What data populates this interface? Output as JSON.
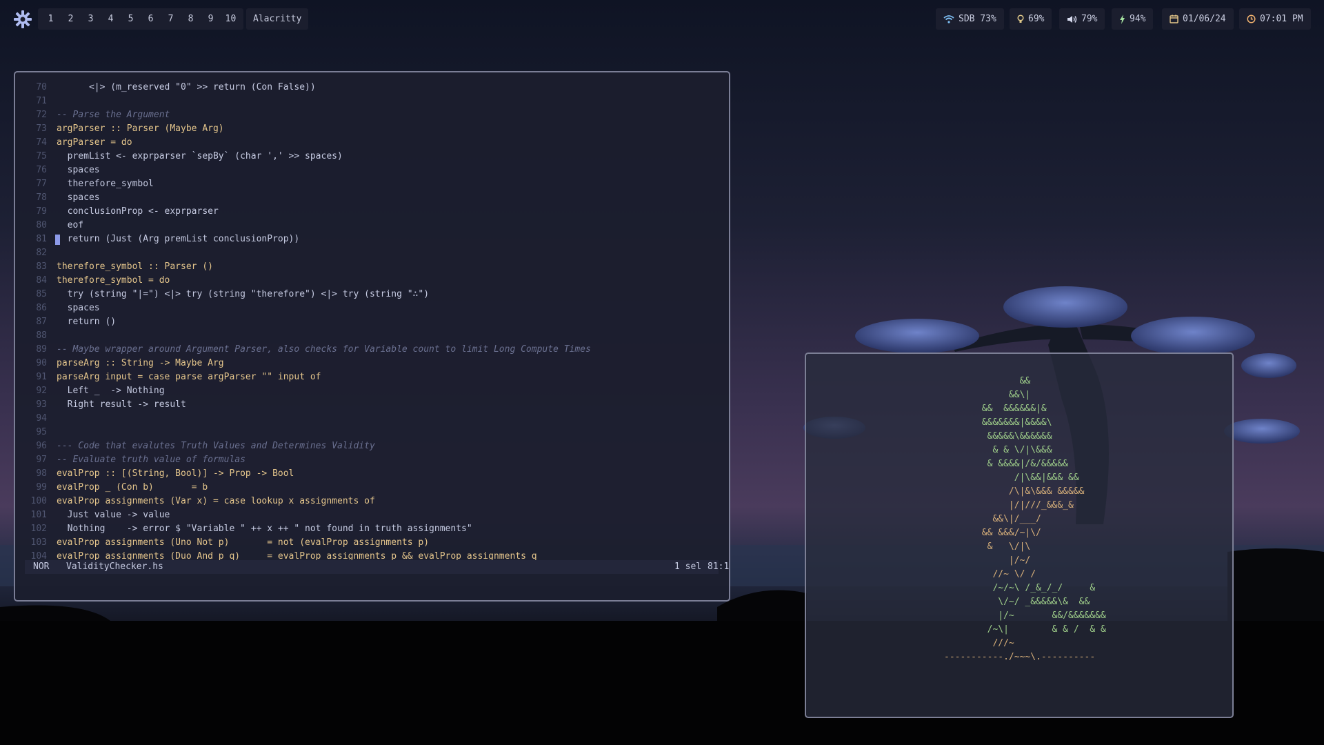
{
  "topbar": {
    "workspaces": [
      "1",
      "2",
      "3",
      "4",
      "5",
      "6",
      "7",
      "8",
      "9",
      "10"
    ],
    "active_app": "Alacritty",
    "status": {
      "wifi": "SDB 73%",
      "brightness": "69%",
      "volume": "79%",
      "battery": "94%",
      "date": "01/06/24",
      "time": "07:01 PM"
    },
    "icons": [
      "settings-icon",
      "wifi-icon",
      "brightness-icon",
      "volume-icon",
      "battery-icon",
      "calendar-icon",
      "clock-icon"
    ]
  },
  "editor": {
    "lines": [
      {
        "n": "70",
        "t": "      <|> (m_reserved \"0\" >> return (Con False))"
      },
      {
        "n": "71",
        "t": ""
      },
      {
        "n": "72",
        "t": "-- Parse the Argument"
      },
      {
        "n": "73",
        "t": "argParser :: Parser (Maybe Arg)"
      },
      {
        "n": "74",
        "t": "argParser = do"
      },
      {
        "n": "75",
        "t": "  premList <- exprparser `sepBy` (char ',' >> spaces)"
      },
      {
        "n": "76",
        "t": "  spaces"
      },
      {
        "n": "77",
        "t": "  therefore_symbol"
      },
      {
        "n": "78",
        "t": "  spaces"
      },
      {
        "n": "79",
        "t": "  conclusionProp <- exprparser"
      },
      {
        "n": "80",
        "t": "  eof"
      },
      {
        "n": "81",
        "t": "  return (Just (Arg premList conclusionProp))"
      },
      {
        "n": "82",
        "t": ""
      },
      {
        "n": "83",
        "t": "therefore_symbol :: Parser ()"
      },
      {
        "n": "84",
        "t": "therefore_symbol = do"
      },
      {
        "n": "85",
        "t": "  try (string \"|=\") <|> try (string \"therefore\") <|> try (string \"∴\")"
      },
      {
        "n": "86",
        "t": "  spaces"
      },
      {
        "n": "87",
        "t": "  return ()"
      },
      {
        "n": "88",
        "t": ""
      },
      {
        "n": "89",
        "t": "-- Maybe wrapper around Argument Parser, also checks for Variable count to limit Long Compute Times"
      },
      {
        "n": "90",
        "t": "parseArg :: String -> Maybe Arg"
      },
      {
        "n": "91",
        "t": "parseArg input = case parse argParser \"\" input of"
      },
      {
        "n": "92",
        "t": "  Left _  -> Nothing"
      },
      {
        "n": "93",
        "t": "  Right result -> result"
      },
      {
        "n": "94",
        "t": ""
      },
      {
        "n": "95",
        "t": ""
      },
      {
        "n": "96",
        "t": "--- Code that evalutes Truth Values and Determines Validity"
      },
      {
        "n": "97",
        "t": "-- Evaluate truth value of formulas"
      },
      {
        "n": "98",
        "t": "evalProp :: [(String, Bool)] -> Prop -> Bool"
      },
      {
        "n": "99",
        "t": "evalProp _ (Con b)       = b"
      },
      {
        "n": "100",
        "t": "evalProp assignments (Var x) = case lookup x assignments of"
      },
      {
        "n": "101",
        "t": "  Just value -> value"
      },
      {
        "n": "102",
        "t": "  Nothing    -> error $ \"Variable \" ++ x ++ \" not found in truth assignments\""
      },
      {
        "n": "103",
        "t": "evalProp assignments (Uno Not p)       = not (evalProp assignments p)"
      },
      {
        "n": "104",
        "t": "evalProp assignments (Duo And p q)     = evalProp assignments p && evalProp assignments q"
      }
    ],
    "cursor_line": "81",
    "status": {
      "mode": "NOR",
      "filename": "ValidityChecker.hs",
      "selections": "1 sel",
      "position": "81:1"
    }
  },
  "ascii_art": [
    "              &&",
    "            &&\\|",
    "       &&  &&&&&&|&",
    "       &&&&&&&|&&&&\\",
    "        &&&&&\\&&&&&&",
    "         & & \\/|\\&&&",
    "        & &&&&|/&/&&&&&",
    "             /|\\&&|&&& &&",
    "            /\\|&\\&&& &&&&&",
    "            |/|///_&&&_&",
    "         &&\\|/___/",
    "       && &&&/~|\\/",
    "        &   \\/|\\",
    "            |/~/",
    "         //~ \\/ /",
    "         /~/~\\ /_&_/_/     &",
    "          \\/~/ _&&&&&\\&  &&",
    "          |/~       &&/&&&&&&&",
    "        /~\\|        & & /  & &",
    "         ///~",
    "-----------./~~~\\.----------"
  ],
  "colors": {
    "editor_bg": "#1c1e2e",
    "accent": "#8c9ae8",
    "string": "#a6e3a1",
    "type": "#e5c68c",
    "comment": "#6a7090"
  }
}
